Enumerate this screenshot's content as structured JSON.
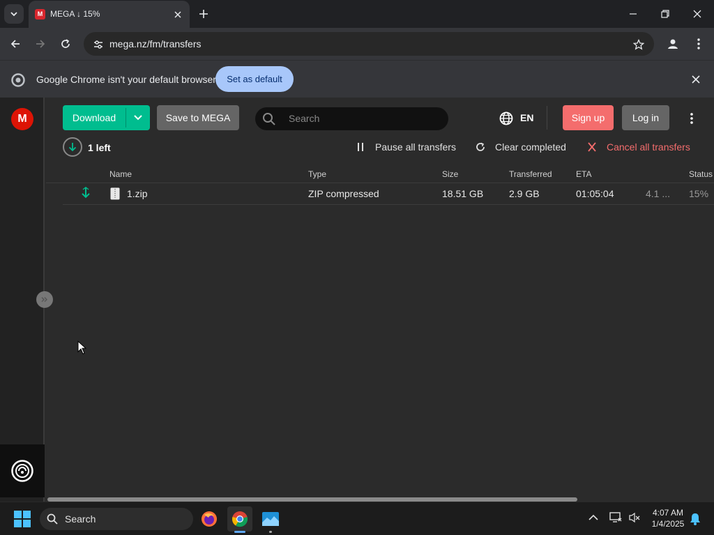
{
  "browser": {
    "tab_title": "MEGA ↓ 15%",
    "tab_favicon": "M",
    "url": "mega.nz/fm/transfers",
    "infobar_message": "Google Chrome isn't your default browser",
    "infobar_button": "Set as default"
  },
  "toolbar": {
    "download_label": "Download",
    "save_label": "Save to MEGA",
    "search_placeholder": "Search",
    "language": "EN",
    "signup_label": "Sign up",
    "login_label": "Log in"
  },
  "transfers": {
    "left_count": "1 left",
    "pause_all": "Pause all transfers",
    "clear_completed": "Clear completed",
    "cancel_all": "Cancel all transfers",
    "columns": {
      "name": "Name",
      "type": "Type",
      "size": "Size",
      "transferred": "Transferred",
      "eta": "ETA",
      "status": "Status"
    },
    "rows": [
      {
        "name": "1.zip",
        "type": "ZIP compressed",
        "size": "18.51 GB",
        "transferred": "2.9 GB",
        "eta": "01:05:04",
        "speed": "4.1 ...",
        "status": "15%",
        "direction": "download"
      }
    ]
  },
  "sidebar": {
    "logo": "M"
  },
  "taskbar": {
    "search_label": "Search",
    "time": "4:07 AM",
    "date": "1/4/2025"
  },
  "colors": {
    "mega_red": "#dd1405",
    "download_green": "#00bd8f",
    "signup_red": "#f46d6d",
    "chrome_blue": "#a8c7fa"
  }
}
